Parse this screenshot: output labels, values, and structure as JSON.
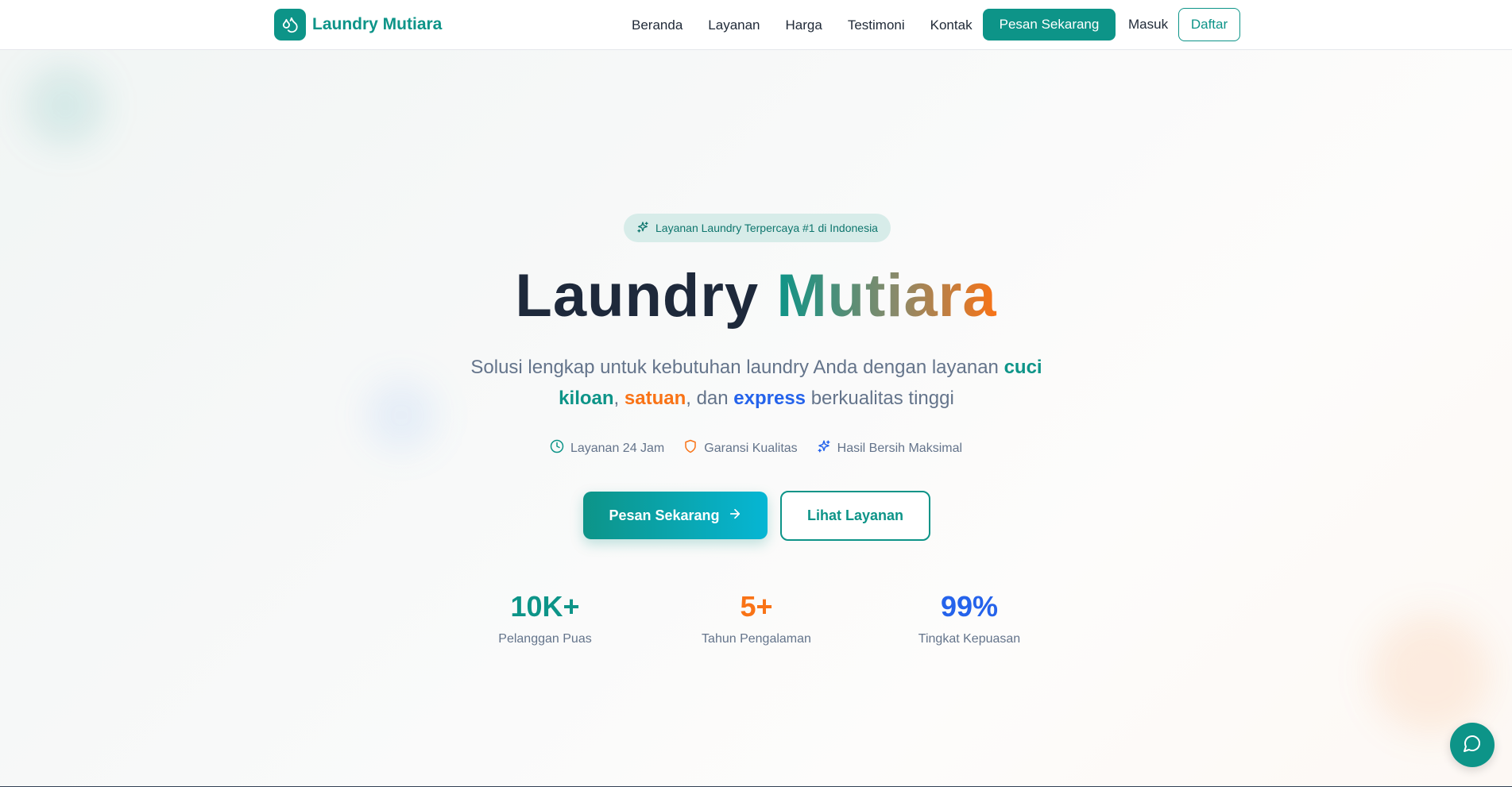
{
  "header": {
    "brand": "Laundry Mutiara",
    "logo_icon": "droplets-icon",
    "nav": [
      {
        "label": "Beranda"
      },
      {
        "label": "Layanan"
      },
      {
        "label": "Harga"
      },
      {
        "label": "Testimoni"
      },
      {
        "label": "Kontak"
      }
    ],
    "order_label": "Pesan Sekarang",
    "login_label": "Masuk",
    "register_label": "Daftar"
  },
  "hero": {
    "badge_icon": "sparkles-icon",
    "badge_text": "Layanan Laundry Terpercaya #1 di Indonesia",
    "title_part1": "Laundry",
    "title_part2": "Mutiara",
    "subtitle": {
      "text1": "Solusi lengkap untuk kebutuhan laundry Anda dengan layanan ",
      "hl1": "cuci kiloan",
      "sep1": ", ",
      "hl2": "satuan",
      "sep2": ", dan ",
      "hl3": "express",
      "text2": " berkualitas tinggi"
    },
    "features": [
      {
        "icon": "clock-icon",
        "label": "Layanan 24 Jam"
      },
      {
        "icon": "shield-icon",
        "label": "Garansi Kualitas"
      },
      {
        "icon": "sparkles-icon",
        "label": "Hasil Bersih Maksimal"
      }
    ],
    "primary_button": "Pesan Sekarang",
    "secondary_button": "Lihat Layanan"
  },
  "stats": [
    {
      "value": "10K+",
      "label": "Pelanggan Puas",
      "color": "#0d9488"
    },
    {
      "value": "5+",
      "label": "Tahun Pengalaman",
      "color": "#f97316"
    },
    {
      "value": "99%",
      "label": "Tingkat Kepuasan",
      "color": "#2563eb"
    }
  ],
  "colors": {
    "primary": "#0d9488",
    "accent_orange": "#f97316",
    "accent_blue": "#2563eb"
  },
  "chat_button_icon": "message-circle-icon"
}
